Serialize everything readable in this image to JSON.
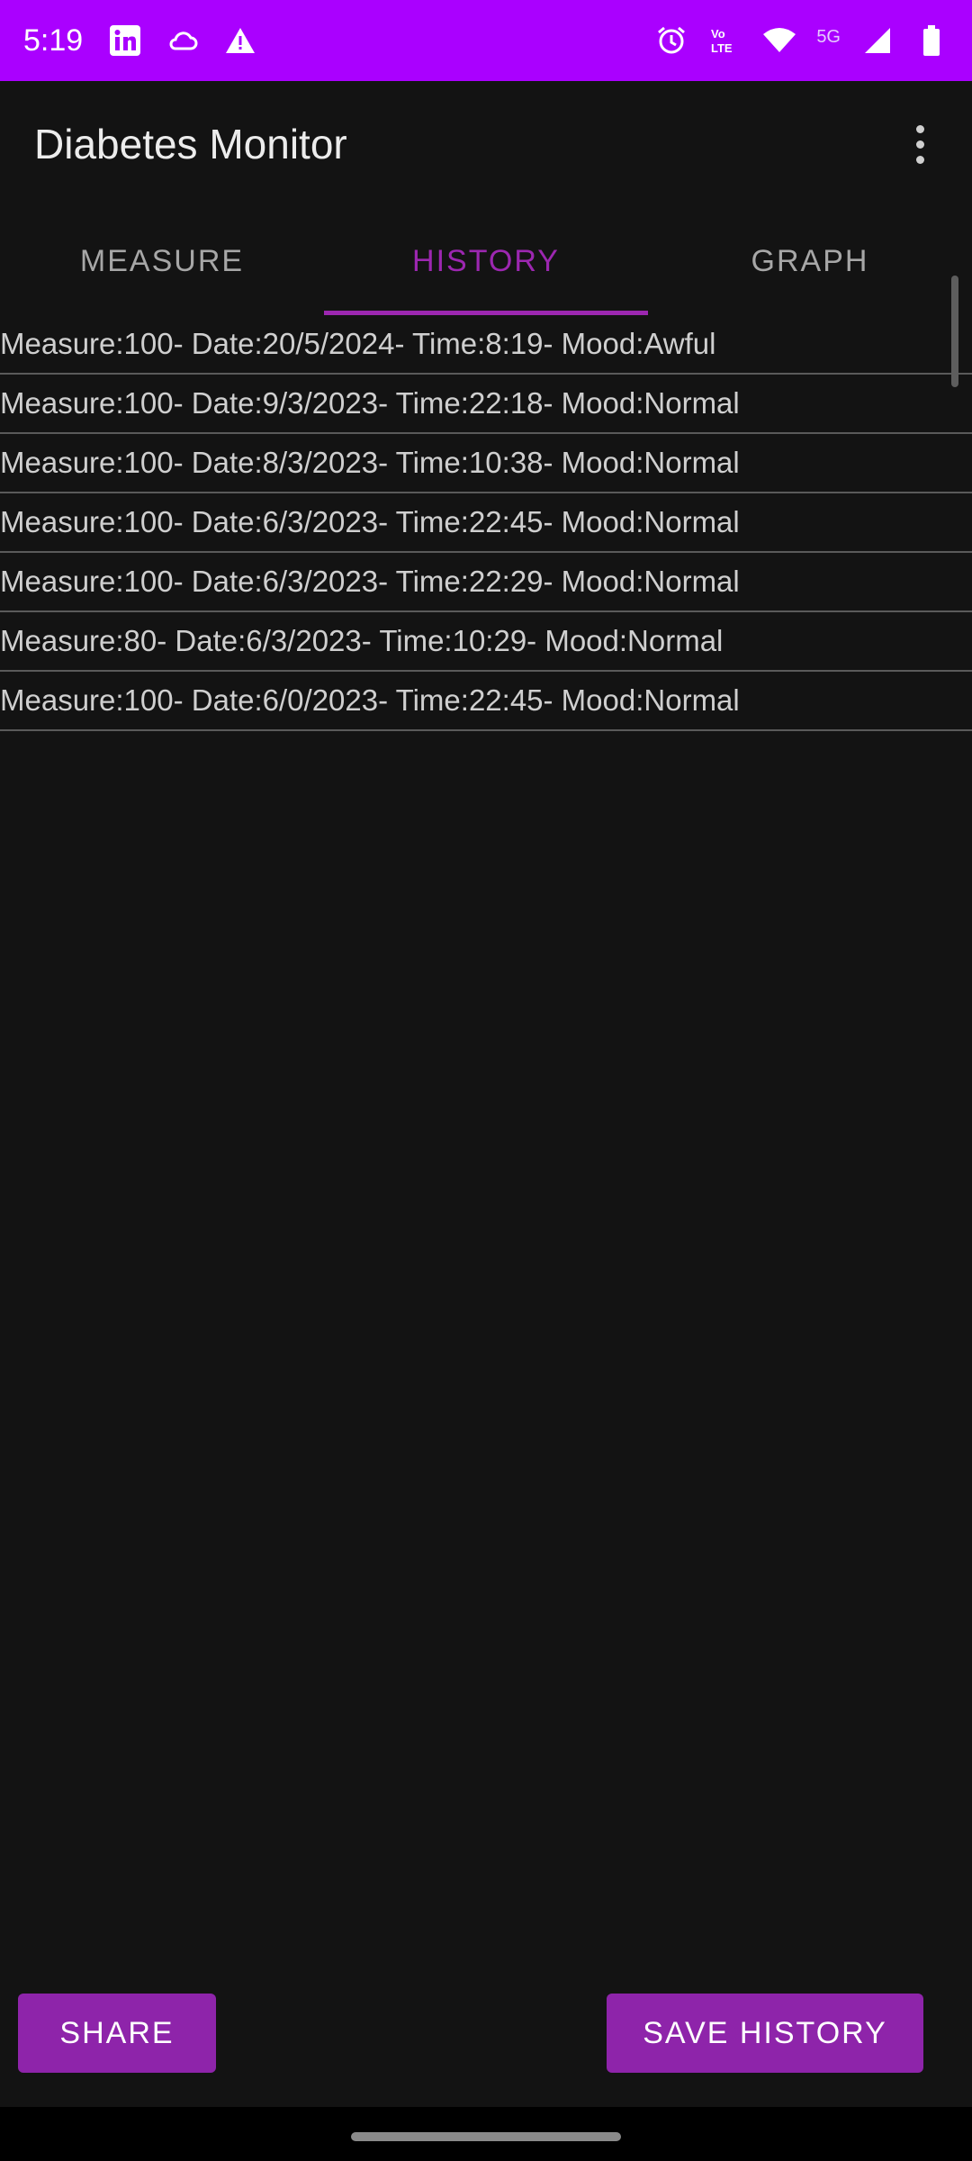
{
  "status_bar": {
    "time": "5:19",
    "network_label": "5G",
    "icons": [
      "linkedin-icon",
      "cloud-icon",
      "warning-icon",
      "alarm-icon",
      "volte-icon",
      "wifi-icon",
      "signal-icon",
      "battery-icon"
    ],
    "background_color": "#aa00ff"
  },
  "app_bar": {
    "title": "Diabetes Monitor",
    "menu_icon": "more-vert-icon"
  },
  "tabs": [
    {
      "label": "MEASURE",
      "active": false
    },
    {
      "label": "HISTORY",
      "active": true
    },
    {
      "label": "GRAPH",
      "active": false
    }
  ],
  "history": [
    "Measure:100- Date:20/5/2024- Time:8:19- Mood:Awful",
    "Measure:100- Date:9/3/2023- Time:22:18- Mood:Normal",
    "Measure:100- Date:8/3/2023- Time:10:38- Mood:Normal",
    "Measure:100- Date:6/3/2023- Time:22:45- Mood:Normal",
    "Measure:100- Date:6/3/2023- Time:22:29- Mood:Normal",
    "Measure:80- Date:6/3/2023- Time:10:29- Mood:Normal",
    "Measure:100- Date:6/0/2023- Time:22:45- Mood:Normal"
  ],
  "buttons": {
    "share": "SHARE",
    "save_history": "SAVE HISTORY"
  },
  "colors": {
    "accent": "#9c27b0",
    "button": "#8e24aa",
    "background": "#131313"
  }
}
